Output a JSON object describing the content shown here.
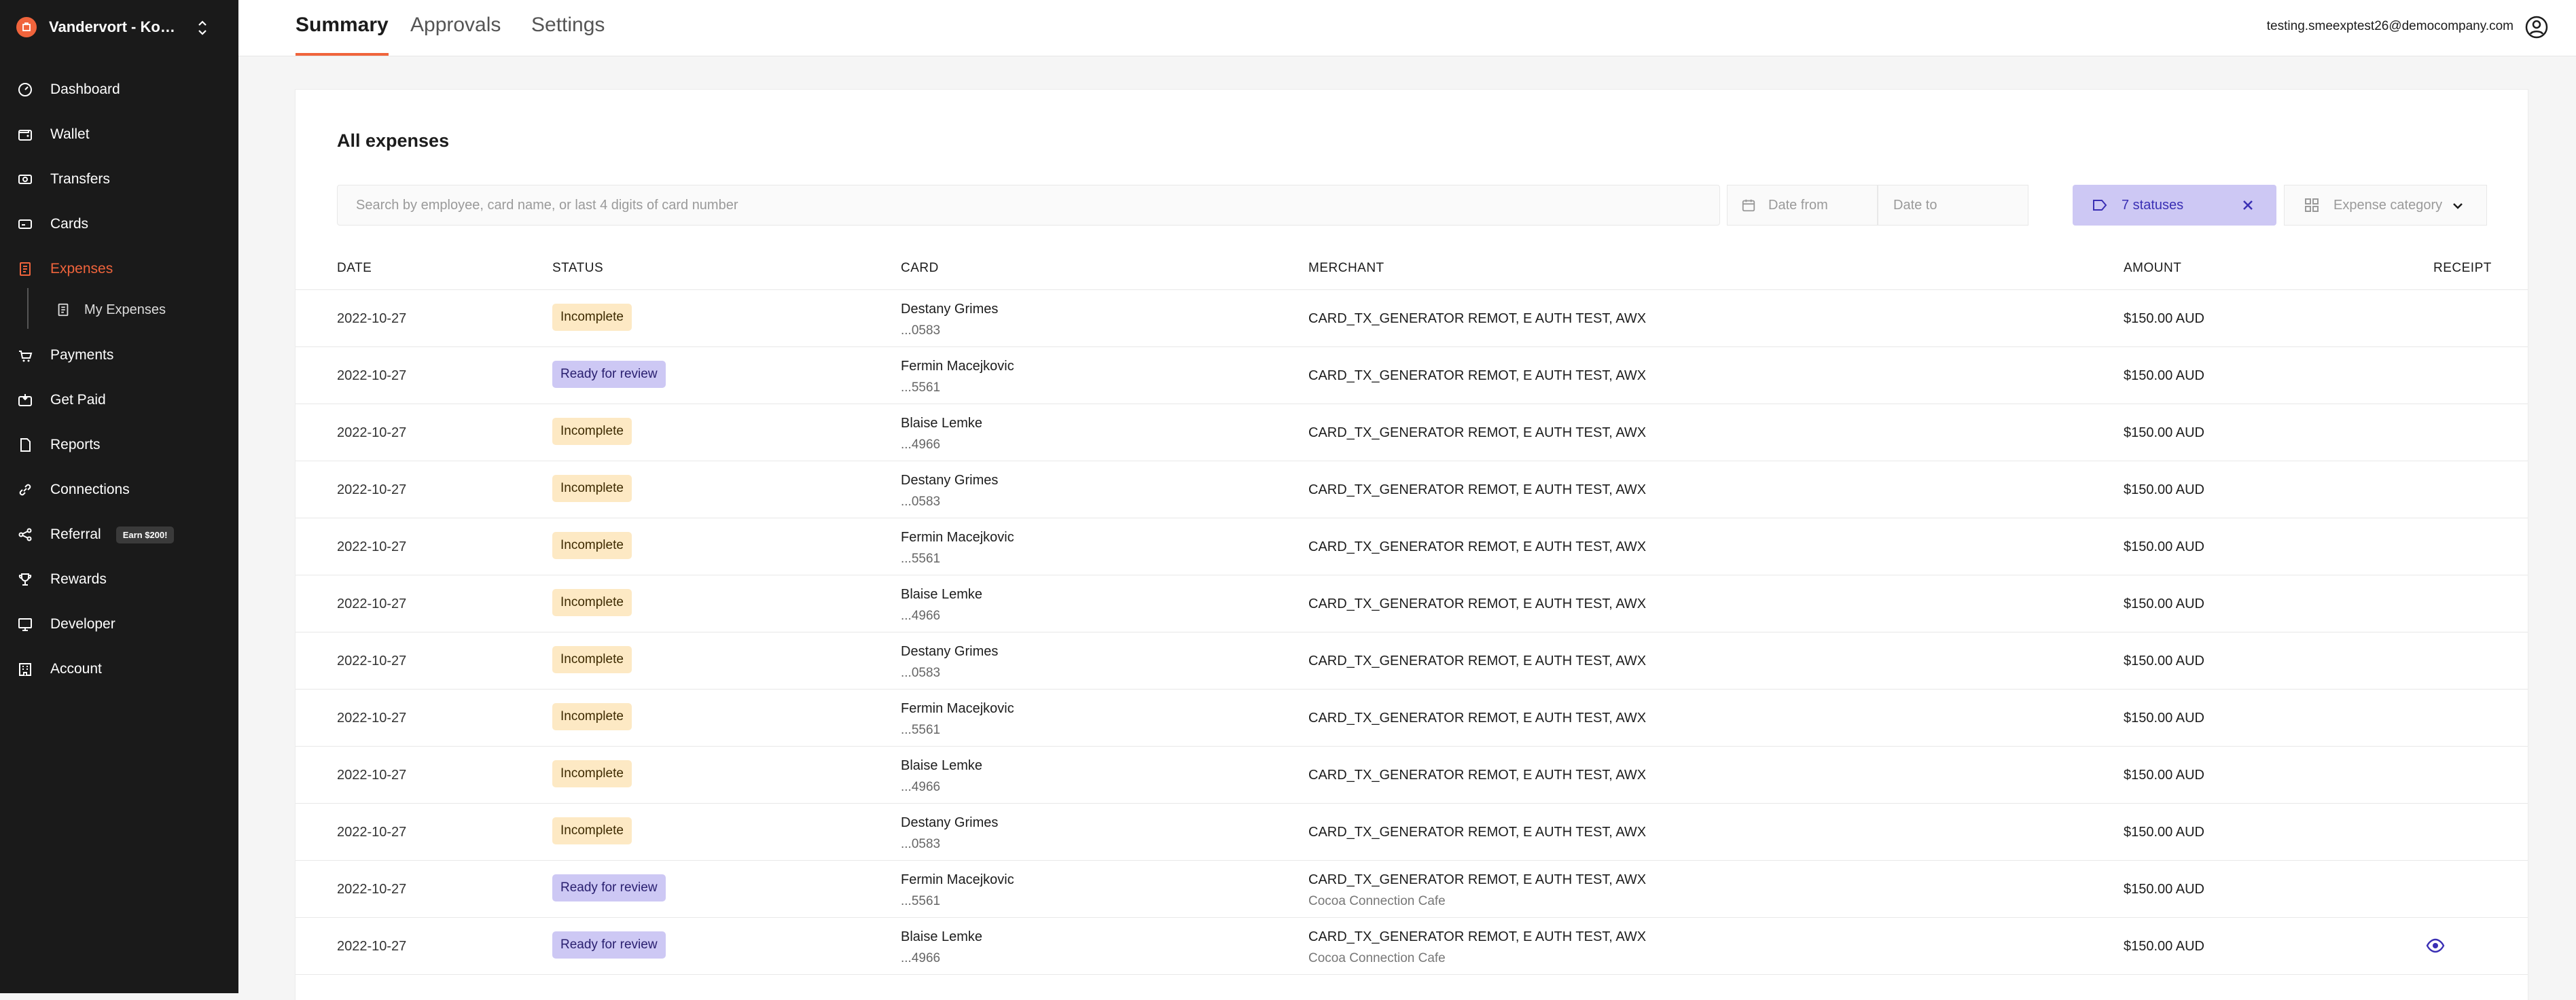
{
  "org": {
    "name": "Vandervort - Koc..."
  },
  "nav": {
    "items": [
      {
        "label": "Dashboard",
        "icon": "dashboard-icon"
      },
      {
        "label": "Wallet",
        "icon": "wallet-icon"
      },
      {
        "label": "Transfers",
        "icon": "transfers-icon"
      },
      {
        "label": "Cards",
        "icon": "cards-icon"
      },
      {
        "label": "Expenses",
        "icon": "expenses-icon",
        "active": true
      },
      {
        "label": "My Expenses",
        "icon": "document-icon",
        "sub": true
      },
      {
        "label": "Payments",
        "icon": "payments-icon"
      },
      {
        "label": "Get Paid",
        "icon": "get-paid-icon"
      },
      {
        "label": "Reports",
        "icon": "reports-icon"
      },
      {
        "label": "Connections",
        "icon": "link-icon"
      },
      {
        "label": "Referral",
        "icon": "share-icon",
        "badge": "Earn $200!"
      },
      {
        "label": "Rewards",
        "icon": "trophy-icon"
      },
      {
        "label": "Developer",
        "icon": "monitor-icon"
      },
      {
        "label": "Account",
        "icon": "building-icon"
      }
    ]
  },
  "tabs": [
    "Summary",
    "Approvals",
    "Settings"
  ],
  "user": {
    "email": "testing.smeexptest26@democompany.com"
  },
  "page": {
    "title": "All expenses"
  },
  "filters": {
    "search_placeholder": "Search by employee, card name, or last 4 digits of card number",
    "date_from_placeholder": "Date from",
    "date_to_placeholder": "Date to",
    "status_label": "7 statuses",
    "category_placeholder": "Expense category"
  },
  "table": {
    "headers": [
      "DATE",
      "STATUS",
      "CARD",
      "MERCHANT",
      "AMOUNT",
      "RECEIPT"
    ],
    "rows": [
      {
        "date": "2022-10-27",
        "status": "Incomplete",
        "status_kind": "incomplete",
        "card_holder": "Destany Grimes",
        "card_last4": "...0583",
        "merchant": "CARD_TX_GENERATOR REMOT, E AUTH TEST, AWX",
        "merchant_sub": "",
        "amount": "$150.00 AUD",
        "receipt": false
      },
      {
        "date": "2022-10-27",
        "status": "Ready for review",
        "status_kind": "review",
        "card_holder": "Fermin Macejkovic",
        "card_last4": "...5561",
        "merchant": "CARD_TX_GENERATOR REMOT, E AUTH TEST, AWX",
        "merchant_sub": "",
        "amount": "$150.00 AUD",
        "receipt": false
      },
      {
        "date": "2022-10-27",
        "status": "Incomplete",
        "status_kind": "incomplete",
        "card_holder": "Blaise Lemke",
        "card_last4": "...4966",
        "merchant": "CARD_TX_GENERATOR REMOT, E AUTH TEST, AWX",
        "merchant_sub": "",
        "amount": "$150.00 AUD",
        "receipt": false
      },
      {
        "date": "2022-10-27",
        "status": "Incomplete",
        "status_kind": "incomplete",
        "card_holder": "Destany Grimes",
        "card_last4": "...0583",
        "merchant": "CARD_TX_GENERATOR REMOT, E AUTH TEST, AWX",
        "merchant_sub": "",
        "amount": "$150.00 AUD",
        "receipt": false
      },
      {
        "date": "2022-10-27",
        "status": "Incomplete",
        "status_kind": "incomplete",
        "card_holder": "Fermin Macejkovic",
        "card_last4": "...5561",
        "merchant": "CARD_TX_GENERATOR REMOT, E AUTH TEST, AWX",
        "merchant_sub": "",
        "amount": "$150.00 AUD",
        "receipt": false
      },
      {
        "date": "2022-10-27",
        "status": "Incomplete",
        "status_kind": "incomplete",
        "card_holder": "Blaise Lemke",
        "card_last4": "...4966",
        "merchant": "CARD_TX_GENERATOR REMOT, E AUTH TEST, AWX",
        "merchant_sub": "",
        "amount": "$150.00 AUD",
        "receipt": false
      },
      {
        "date": "2022-10-27",
        "status": "Incomplete",
        "status_kind": "incomplete",
        "card_holder": "Destany Grimes",
        "card_last4": "...0583",
        "merchant": "CARD_TX_GENERATOR REMOT, E AUTH TEST, AWX",
        "merchant_sub": "",
        "amount": "$150.00 AUD",
        "receipt": false
      },
      {
        "date": "2022-10-27",
        "status": "Incomplete",
        "status_kind": "incomplete",
        "card_holder": "Fermin Macejkovic",
        "card_last4": "...5561",
        "merchant": "CARD_TX_GENERATOR REMOT, E AUTH TEST, AWX",
        "merchant_sub": "",
        "amount": "$150.00 AUD",
        "receipt": false
      },
      {
        "date": "2022-10-27",
        "status": "Incomplete",
        "status_kind": "incomplete",
        "card_holder": "Blaise Lemke",
        "card_last4": "...4966",
        "merchant": "CARD_TX_GENERATOR REMOT, E AUTH TEST, AWX",
        "merchant_sub": "",
        "amount": "$150.00 AUD",
        "receipt": false
      },
      {
        "date": "2022-10-27",
        "status": "Incomplete",
        "status_kind": "incomplete",
        "card_holder": "Destany Grimes",
        "card_last4": "...0583",
        "merchant": "CARD_TX_GENERATOR REMOT, E AUTH TEST, AWX",
        "merchant_sub": "",
        "amount": "$150.00 AUD",
        "receipt": false
      },
      {
        "date": "2022-10-27",
        "status": "Ready for review",
        "status_kind": "review",
        "card_holder": "Fermin Macejkovic",
        "card_last4": "...5561",
        "merchant": "CARD_TX_GENERATOR REMOT, E AUTH TEST, AWX",
        "merchant_sub": "Cocoa Connection Cafe",
        "amount": "$150.00 AUD",
        "receipt": false
      },
      {
        "date": "2022-10-27",
        "status": "Ready for review",
        "status_kind": "review",
        "card_holder": "Blaise Lemke",
        "card_last4": "...4966",
        "merchant": "CARD_TX_GENERATOR REMOT, E AUTH TEST, AWX",
        "merchant_sub": "Cocoa Connection Cafe",
        "amount": "$150.00 AUD",
        "receipt": true
      }
    ]
  },
  "colors": {
    "accent": "#f0643c",
    "sidebar": "#1a1a1a",
    "review_bg": "#cdc8f4",
    "incomplete_bg": "#fde9c4",
    "link": "#3a2fb4"
  }
}
